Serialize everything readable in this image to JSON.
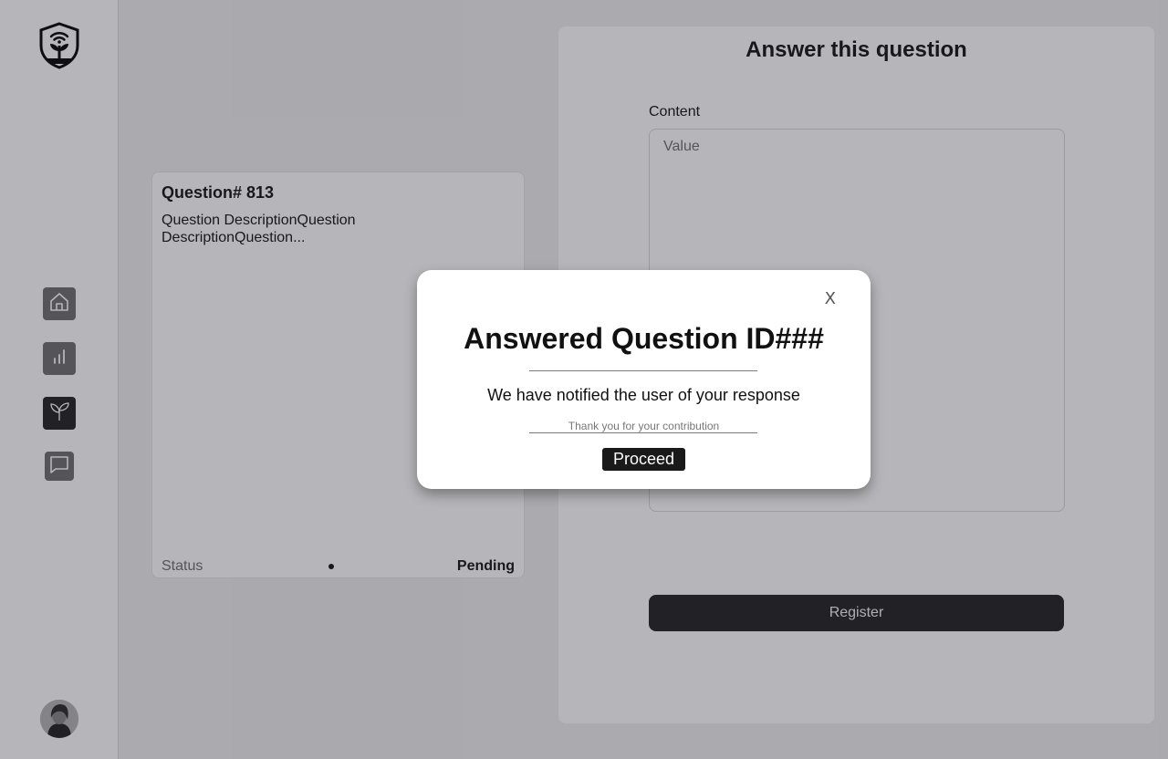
{
  "sidebar": {
    "logo_icon": "shield-plant-logo",
    "nav": [
      {
        "icon": "home-icon",
        "name": "home"
      },
      {
        "icon": "bar-chart-icon",
        "name": "stats"
      },
      {
        "icon": "sprout-icon",
        "name": "plants"
      },
      {
        "icon": "chat-icon",
        "name": "messages"
      }
    ],
    "avatar_icon": "user-avatar"
  },
  "question": {
    "title": "Question# 813",
    "description": "Question DescriptionQuestion DescriptionQuestion...",
    "status_label": "Status",
    "status_value": "Pending"
  },
  "answer_form": {
    "title": "Answer this question",
    "content_label": "Content",
    "content_placeholder": "Value",
    "submit_label": "Register"
  },
  "modal": {
    "close_label": "X",
    "title": "Answered Question ID###",
    "message": "We have notified the user of your response",
    "thanks": "Thank you for your contribution",
    "proceed_label": "Proceed"
  },
  "colors": {
    "sidebar_active": "#2c2c2c",
    "sidebar_button": "#757575",
    "primary_button": "#2c2c2c",
    "overlay": "rgba(12,12,25,0.3)"
  }
}
